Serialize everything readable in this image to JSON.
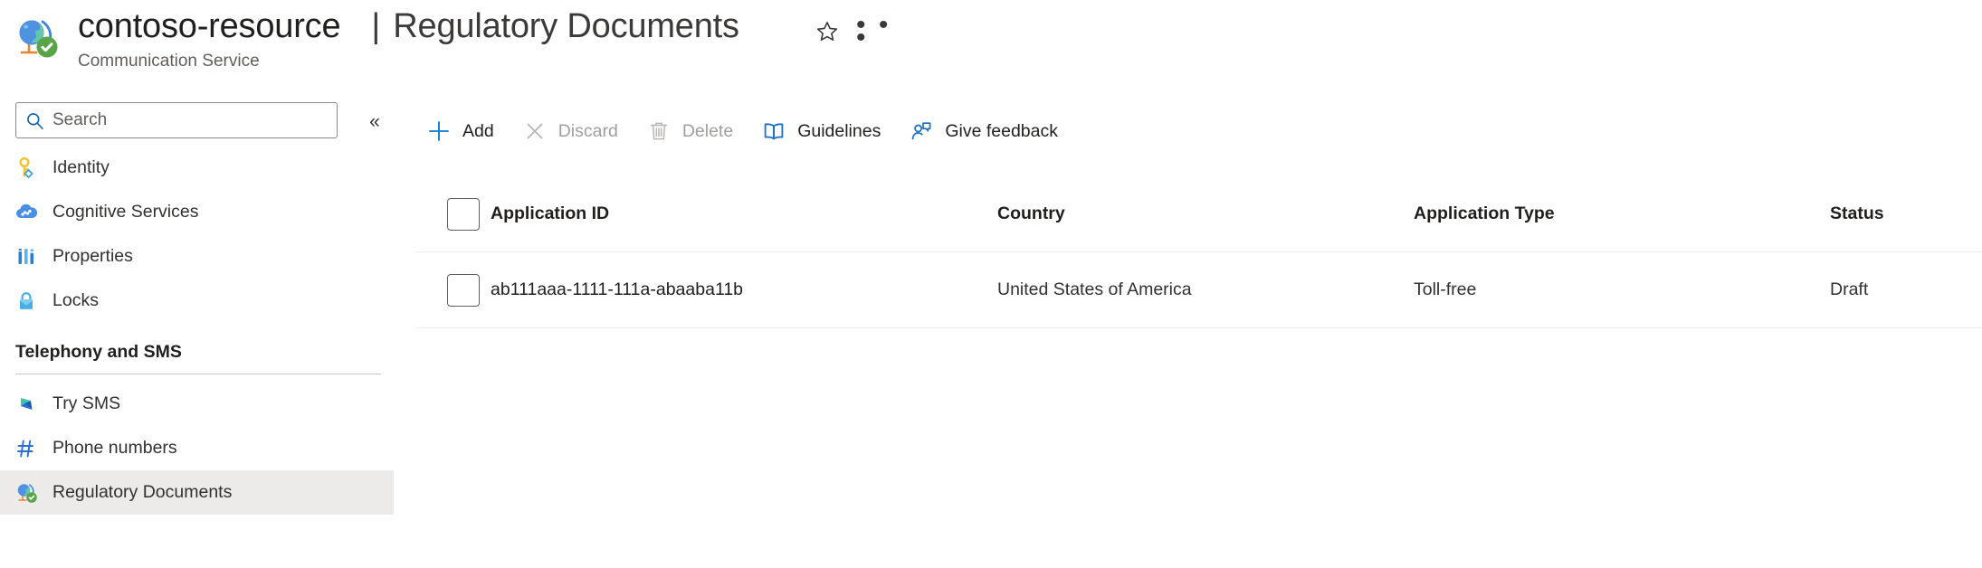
{
  "header": {
    "resource_name": "contoso-resource",
    "separator": "|",
    "page_title": "Regulatory Documents",
    "resource_subtitle": "Communication Service",
    "resource_icon": "globe-check-icon",
    "favorite_icon": "star-outline-icon",
    "more_icon": "ellipsis-icon",
    "more_label": "• • •"
  },
  "sidebar": {
    "search": {
      "placeholder": "Search",
      "value": "",
      "icon": "search-icon"
    },
    "collapse": {
      "icon": "double-chevron-left-icon",
      "glyph": "«"
    },
    "items": [
      {
        "label": "Identity",
        "icon": "key-identity-icon",
        "selected": false
      },
      {
        "label": "Cognitive Services",
        "icon": "cognitive-services-cloud-icon",
        "selected": false
      },
      {
        "label": "Properties",
        "icon": "properties-bars-icon",
        "selected": false
      },
      {
        "label": "Locks",
        "icon": "lock-icon",
        "selected": false
      }
    ],
    "section": {
      "title": "Telephony and SMS",
      "items": [
        {
          "label": "Try SMS",
          "icon": "flag-send-icon",
          "selected": false
        },
        {
          "label": "Phone numbers",
          "icon": "hash-number-icon",
          "selected": false
        },
        {
          "label": "Regulatory Documents",
          "icon": "globe-check-icon",
          "selected": true
        }
      ]
    }
  },
  "command_bar": {
    "commands": [
      {
        "label": "Add",
        "icon": "plus-icon",
        "disabled": false
      },
      {
        "label": "Discard",
        "icon": "close-x-icon",
        "disabled": true
      },
      {
        "label": "Delete",
        "icon": "trash-icon",
        "disabled": true
      },
      {
        "label": "Guidelines",
        "icon": "book-icon",
        "disabled": false
      },
      {
        "label": "Give feedback",
        "icon": "person-feedback-icon",
        "disabled": false
      }
    ]
  },
  "table": {
    "select_all": {
      "name": "select-all-checkbox",
      "checked": false
    },
    "columns": [
      "Application ID",
      "Country",
      "Application Type",
      "Status"
    ],
    "rows": [
      {
        "checked": false,
        "application_id": "ab111aaa-1111-111a-abaaba11b",
        "country": "United States of America",
        "application_type": "Toll-free",
        "status": "Draft"
      }
    ]
  },
  "colors": {
    "accent": "#0078d4",
    "text_primary": "#201f1e",
    "text_secondary": "#605e5c",
    "disabled": "#a19f9d",
    "selected_row_bg": "#edebe9",
    "divider": "#edebe9"
  }
}
